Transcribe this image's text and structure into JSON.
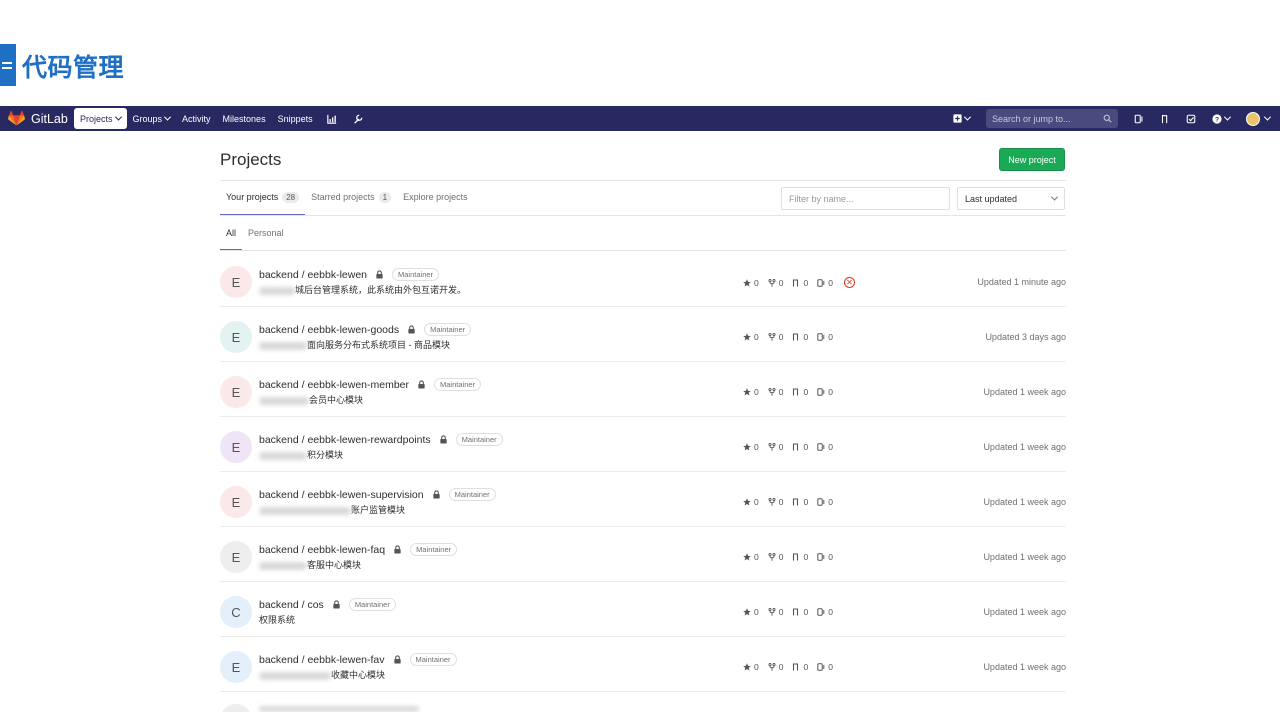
{
  "slide": {
    "title": "代码管理"
  },
  "navbar": {
    "brand": "GitLab",
    "items": [
      {
        "label": "Projects",
        "active": true,
        "dropdown": true
      },
      {
        "label": "Groups",
        "active": false,
        "dropdown": true
      },
      {
        "label": "Activity",
        "active": false,
        "dropdown": false
      },
      {
        "label": "Milestones",
        "active": false,
        "dropdown": false
      },
      {
        "label": "Snippets",
        "active": false,
        "dropdown": false
      }
    ],
    "search_placeholder": "Search or jump to...",
    "colors": {
      "navbar": "#292961",
      "accent": "#1aaa55",
      "active_tab": "#6666c4"
    }
  },
  "page": {
    "title": "Projects",
    "new_project_label": "New project",
    "tabs": [
      {
        "label": "Your projects",
        "count": "28"
      },
      {
        "label": "Starred projects",
        "count": "1"
      },
      {
        "label": "Explore projects",
        "count": ""
      }
    ],
    "filter_placeholder": "Filter by name...",
    "sort_value": "Last updated",
    "subtabs": [
      "All",
      "Personal"
    ]
  },
  "projects": [
    {
      "initial": "E",
      "avatar_color": "#fbe9e9",
      "namespace": "backend / ",
      "name": "eebbk-lewen",
      "role": "Maintainer",
      "desc_visible": "城后台管理系统，此系统由外包互诺开发。",
      "stars": "0",
      "forks": "0",
      "mrs": "0",
      "issues": "0",
      "pipeline_failed": true,
      "updated": "Updated 1 minute ago"
    },
    {
      "initial": "E",
      "avatar_color": "#e3f3f1",
      "namespace": "backend / ",
      "name": "eebbk-lewen-goods",
      "role": "Maintainer",
      "desc_visible": "面向服务分布式系统项目 - 商品模块",
      "stars": "0",
      "forks": "0",
      "mrs": "0",
      "issues": "0",
      "pipeline_failed": false,
      "updated": "Updated 3 days ago"
    },
    {
      "initial": "E",
      "avatar_color": "#fbe9e9",
      "namespace": "backend / ",
      "name": "eebbk-lewen-member",
      "role": "Maintainer",
      "desc_visible": "会员中心模块",
      "stars": "0",
      "forks": "0",
      "mrs": "0",
      "issues": "0",
      "pipeline_failed": false,
      "updated": "Updated 1 week ago"
    },
    {
      "initial": "E",
      "avatar_color": "#efe5f6",
      "namespace": "backend / ",
      "name": "eebbk-lewen-rewardpoints",
      "role": "Maintainer",
      "desc_visible": "积分模块",
      "stars": "0",
      "forks": "0",
      "mrs": "0",
      "issues": "0",
      "pipeline_failed": false,
      "updated": "Updated 1 week ago"
    },
    {
      "initial": "E",
      "avatar_color": "#fbe9e9",
      "namespace": "backend / ",
      "name": "eebbk-lewen-supervision",
      "role": "Maintainer",
      "desc_visible": "账户监管模块",
      "stars": "0",
      "forks": "0",
      "mrs": "0",
      "issues": "0",
      "pipeline_failed": false,
      "updated": "Updated 1 week ago"
    },
    {
      "initial": "E",
      "avatar_color": "#eeeeee",
      "namespace": "backend / ",
      "name": "eebbk-lewen-faq",
      "role": "Maintainer",
      "desc_visible": "客服中心模块",
      "stars": "0",
      "forks": "0",
      "mrs": "0",
      "issues": "0",
      "pipeline_failed": false,
      "updated": "Updated 1 week ago"
    },
    {
      "initial": "C",
      "avatar_color": "#e3effb",
      "namespace": "backend / ",
      "name": "cos",
      "role": "Maintainer",
      "desc_visible": "权限系统",
      "stars": "0",
      "forks": "0",
      "mrs": "0",
      "issues": "0",
      "pipeline_failed": false,
      "updated": "Updated 1 week ago"
    },
    {
      "initial": "E",
      "avatar_color": "#e3effb",
      "namespace": "backend / ",
      "name": "eebbk-lewen-fav",
      "role": "Maintainer",
      "desc_visible": "收藏中心模块",
      "stars": "0",
      "forks": "0",
      "mrs": "0",
      "issues": "0",
      "pipeline_failed": false,
      "updated": "Updated 1 week ago"
    }
  ]
}
